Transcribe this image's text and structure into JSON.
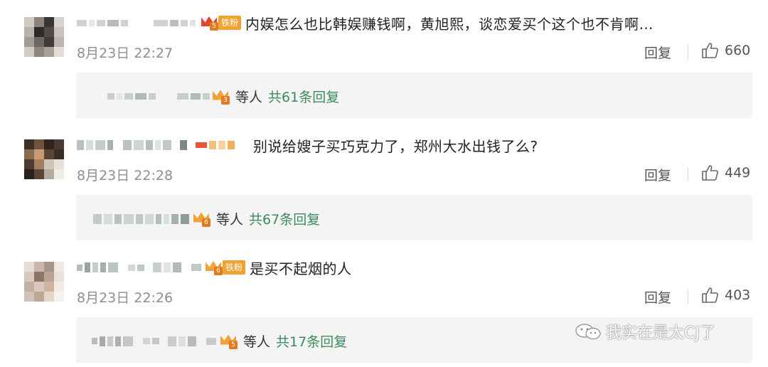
{
  "comments": [
    {
      "badge_level": "5",
      "badge_label": "铁粉",
      "text": "内娱怎么也比韩娱赚钱啊，黄旭熙，谈恋爱买个这个也不肯啊…",
      "time": "8月23日 22:27",
      "reply_label": "回复",
      "likes": "660",
      "sub": {
        "badge_level": "3",
        "etc": "等人",
        "total": "共61条回复"
      }
    },
    {
      "badge_level": "",
      "badge_label": "",
      "text": "别说给嫂子买巧克力了，郑州大水出钱了么?",
      "time": "8月23日 22:28",
      "reply_label": "回复",
      "likes": "449",
      "sub": {
        "badge_level": "6",
        "etc": "等人",
        "total": "共67条回复"
      }
    },
    {
      "badge_level": "6",
      "badge_label": "铁粉",
      "text": "是买不起烟的人",
      "time": "8月23日 22:26",
      "reply_label": "回复",
      "likes": "403",
      "sub": {
        "badge_level": "5",
        "etc": "等人",
        "total": "共17条回复"
      }
    }
  ],
  "watermark": {
    "text": "我实在是太CJ了",
    "icon": "wechat-icon"
  },
  "colors": {
    "link_green": "#3c8b5e",
    "badge_orange": "#f0a331",
    "sub_bg": "#f4f4f5"
  }
}
